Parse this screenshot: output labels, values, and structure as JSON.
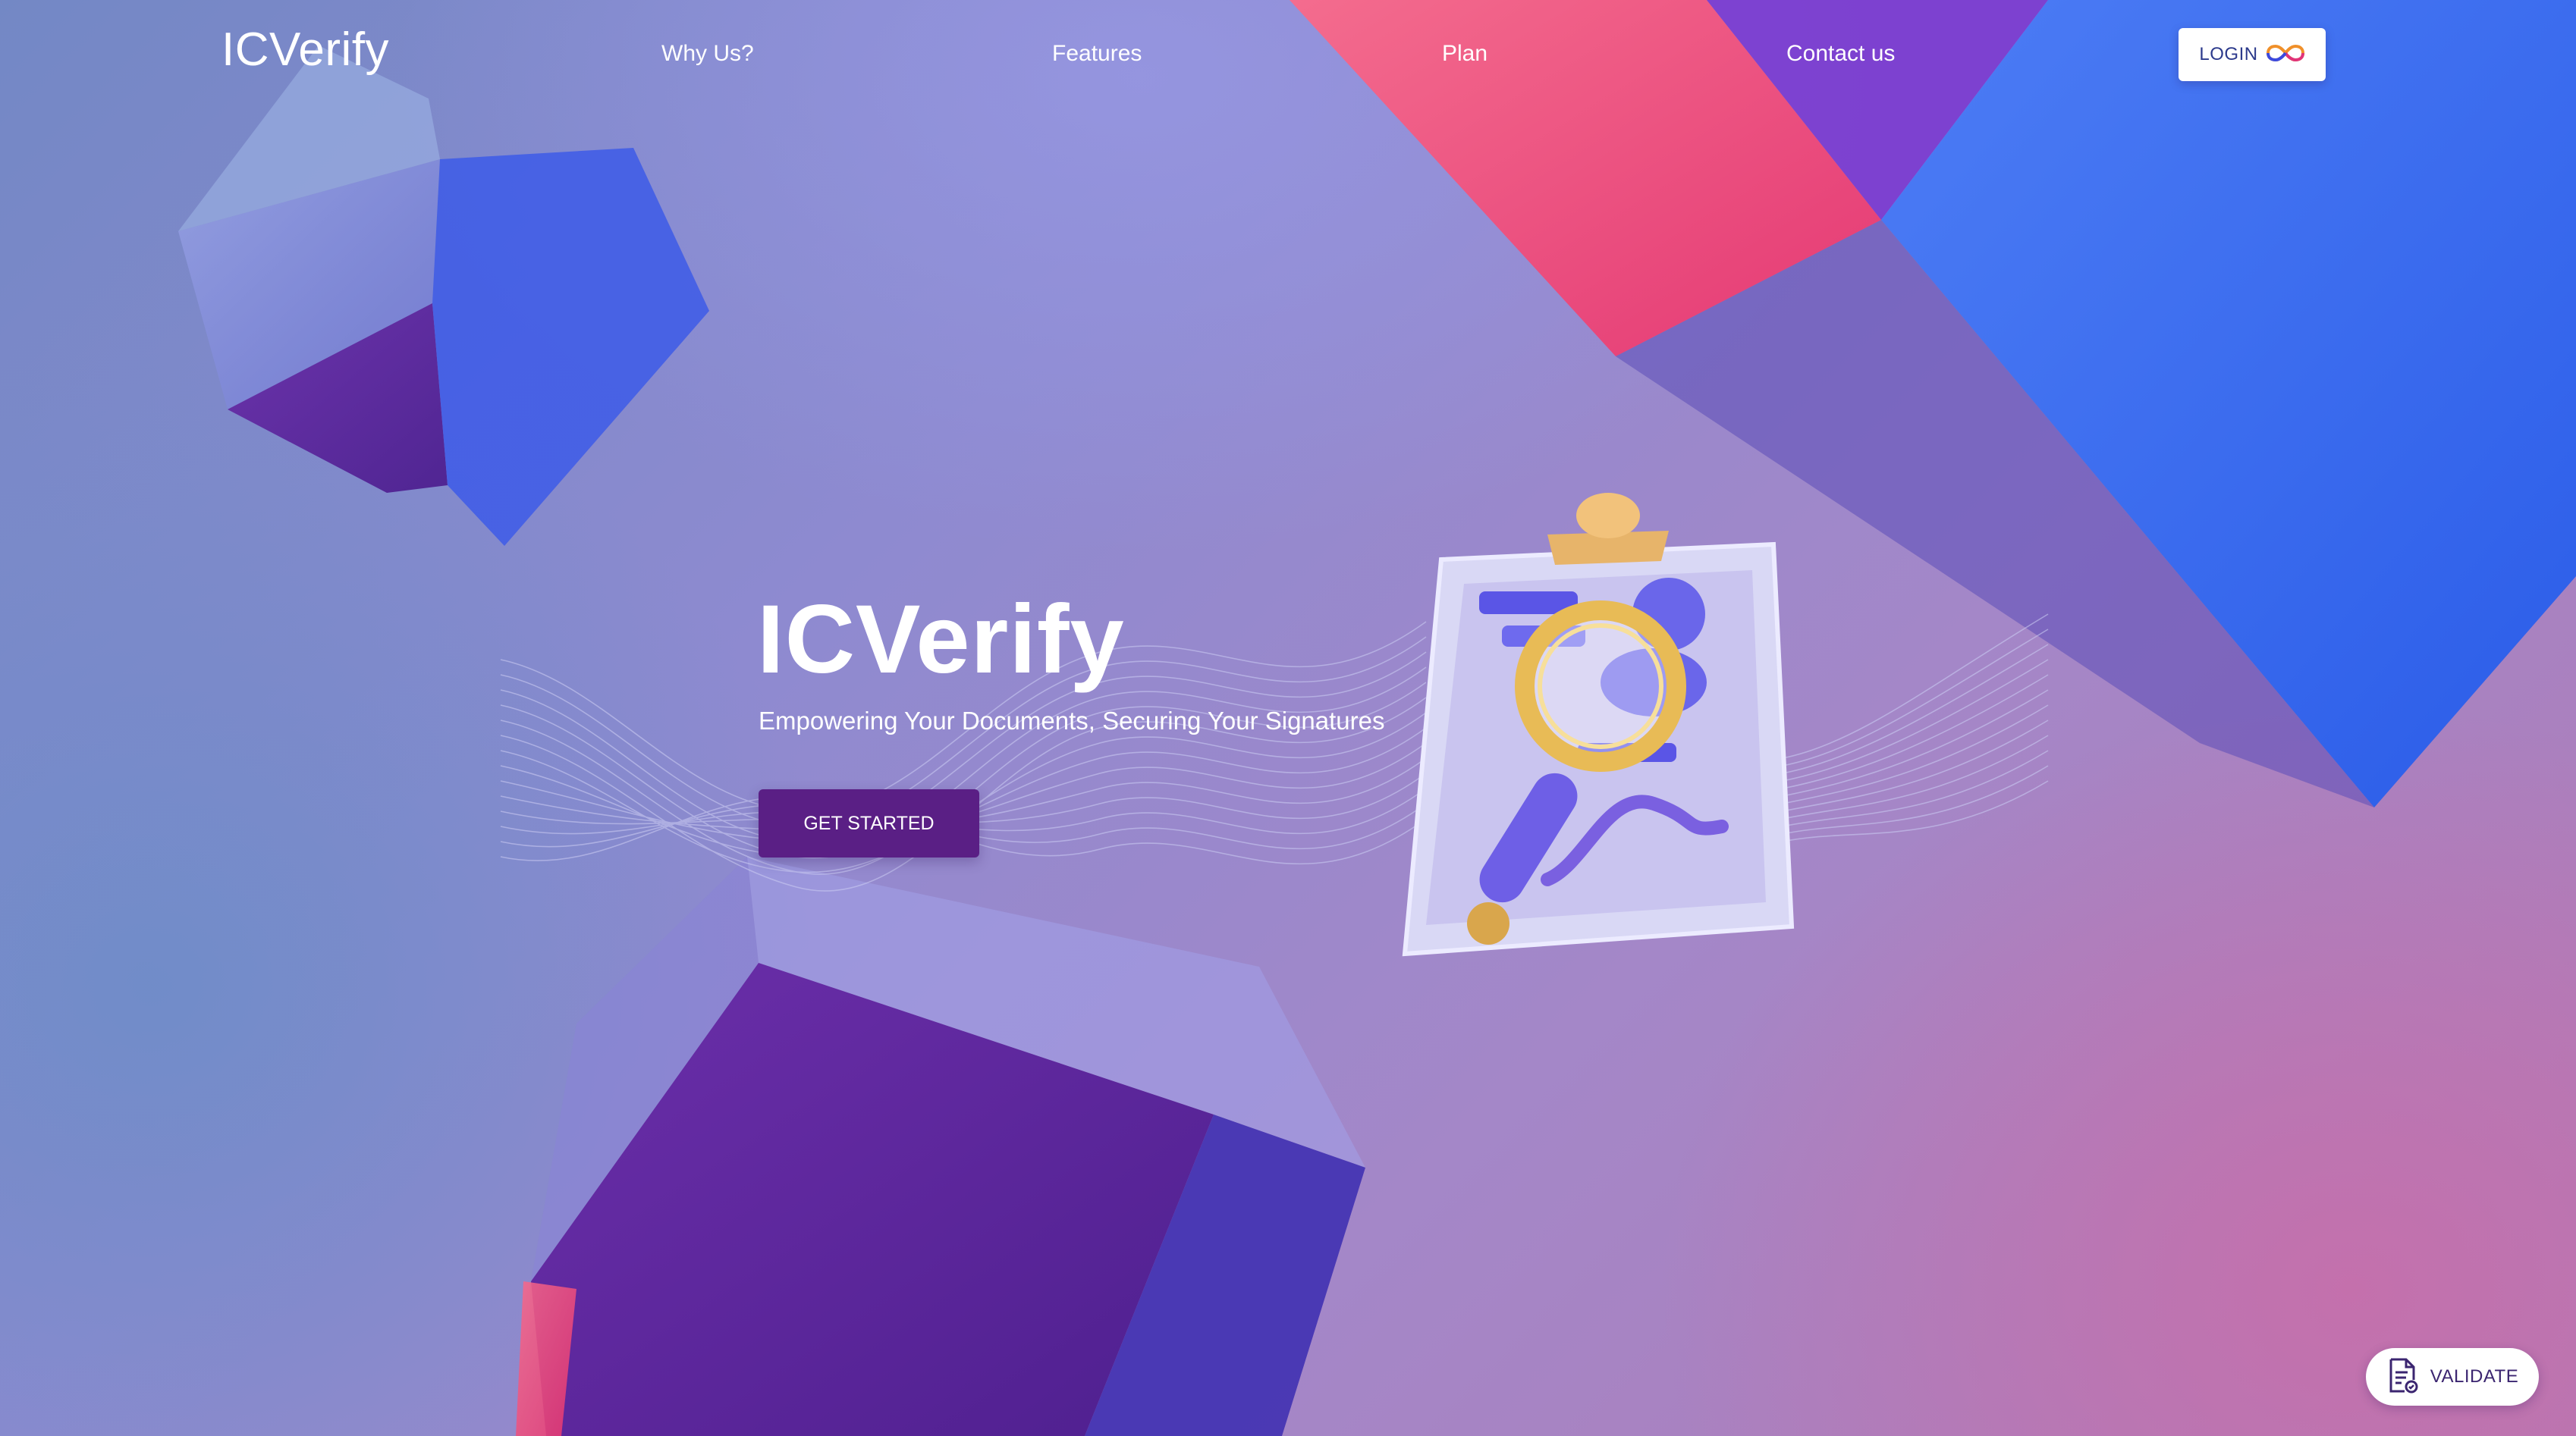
{
  "nav": {
    "logo": "ICVerify",
    "links": [
      {
        "label": "Why Us?"
      },
      {
        "label": "Features"
      },
      {
        "label": "Plan"
      },
      {
        "label": "Contact us"
      }
    ],
    "login_label": "LOGIN",
    "login_icon": "infinity-logo-icon"
  },
  "hero": {
    "title": "ICVerify",
    "subtitle": "Empowering Your Documents, Securing Your Signatures",
    "cta_label": "GET STARTED",
    "illustration": "clipboard-magnifier-illustration"
  },
  "floating": {
    "validate_label": "VALIDATE",
    "validate_icon": "document-check-icon"
  },
  "colors": {
    "cta_bg": "#5a1f85",
    "accent_blue": "#3a6cf0",
    "accent_pink": "#f04a7e",
    "text_white": "#ffffff"
  }
}
